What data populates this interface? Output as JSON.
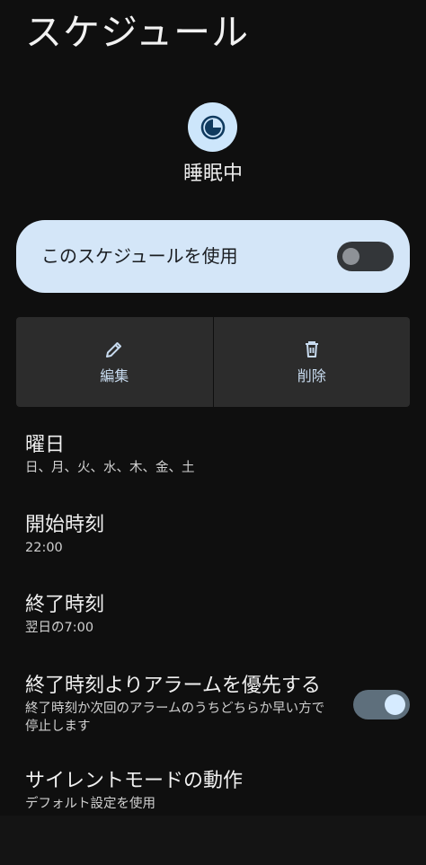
{
  "header": {
    "title": "スケジュール"
  },
  "mode": {
    "name": "睡眠中",
    "icon": "moon-clock-icon"
  },
  "use_schedule": {
    "label": "このスケジュールを使用",
    "enabled": false
  },
  "actions": {
    "edit_label": "編集",
    "edit_icon": "pencil-icon",
    "delete_label": "削除",
    "delete_icon": "trash-icon"
  },
  "settings": {
    "days": {
      "title": "曜日",
      "value": "日、月、火、水、木、金、土"
    },
    "start_time": {
      "title": "開始時刻",
      "value": "22:00"
    },
    "end_time": {
      "title": "終了時刻",
      "value": "翌日の7:00"
    },
    "alarm_override": {
      "title": "終了時刻よりアラームを優先する",
      "description": "終了時刻か次回のアラームのうちどちらか早い方で停止します",
      "enabled": true
    },
    "dnd_behavior": {
      "title": "サイレントモードの動作",
      "value": "デフォルト設定を使用"
    }
  },
  "colors": {
    "background": "#0f0f0f",
    "card_accent": "#d4e6f8",
    "icon_circle": "#cde6fb",
    "button_bg": "#2c2c2c",
    "switch_on_track": "#5e6f7c",
    "switch_on_knob": "#d6ebff"
  }
}
